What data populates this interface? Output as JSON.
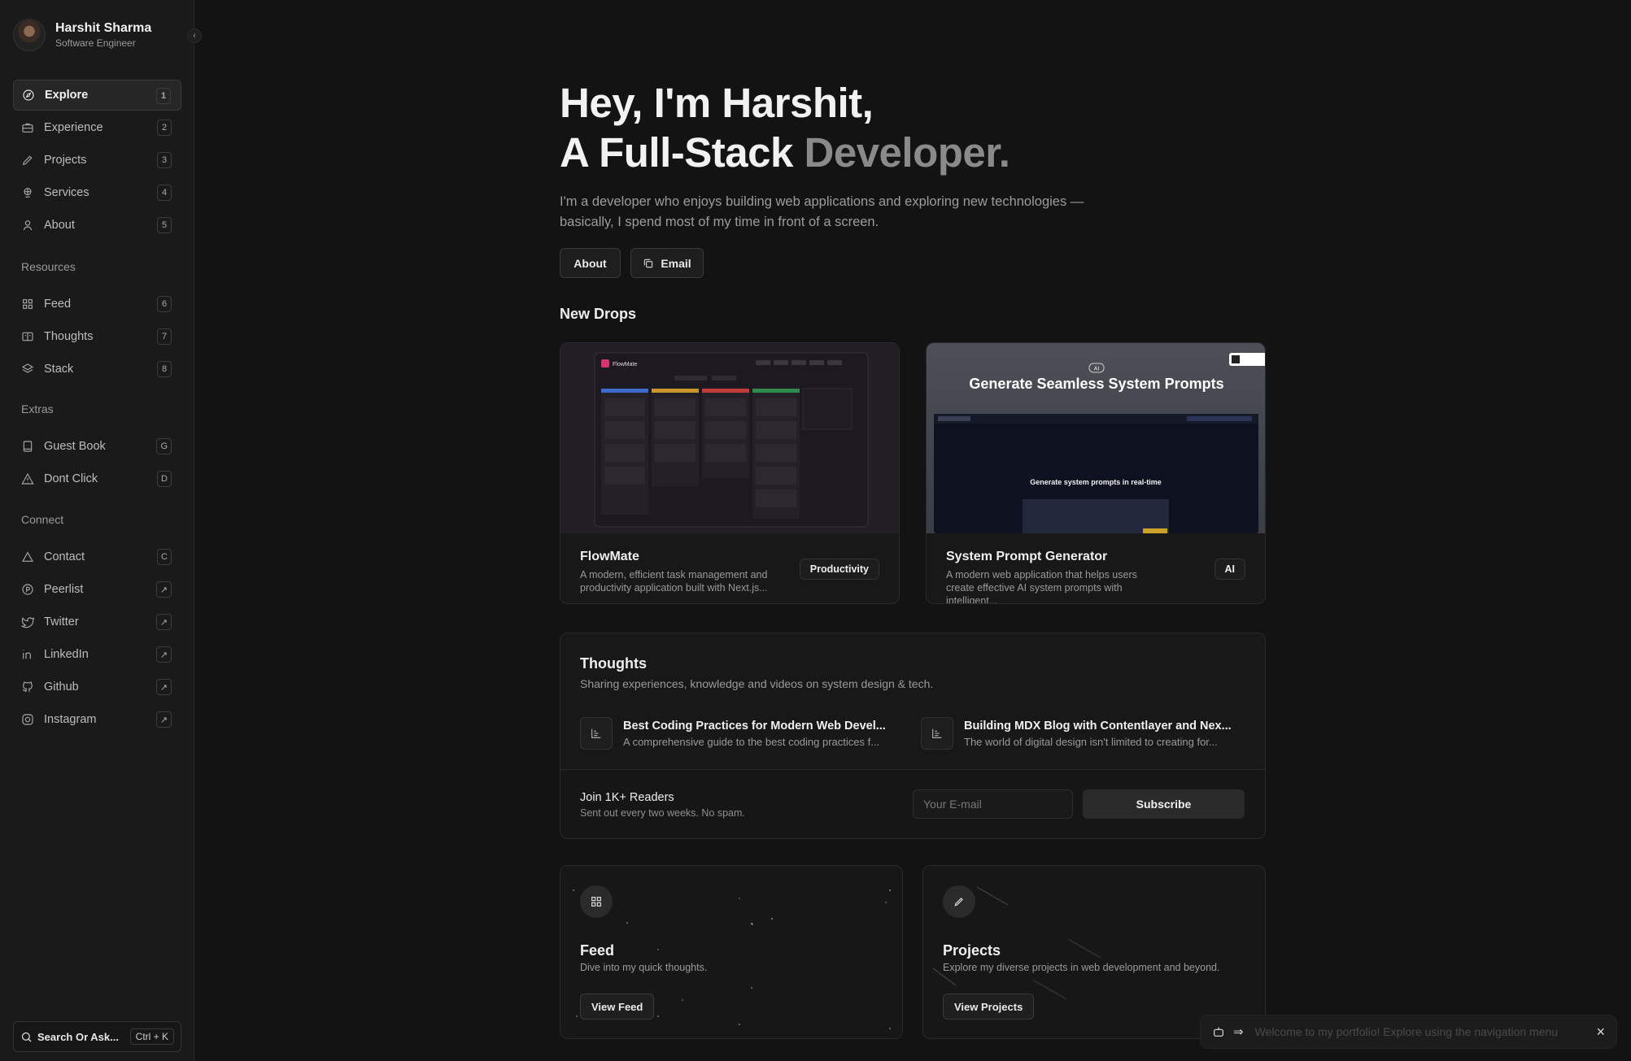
{
  "profile": {
    "name": "Harshit Sharma",
    "role": "Software Engineer"
  },
  "sidebar": {
    "main_items": [
      {
        "label": "Explore",
        "key": "1",
        "icon": "compass-icon"
      },
      {
        "label": "Experience",
        "key": "2",
        "icon": "briefcase-icon"
      },
      {
        "label": "Projects",
        "key": "3",
        "icon": "pencil-icon"
      },
      {
        "label": "Services",
        "key": "4",
        "icon": "services-icon"
      },
      {
        "label": "About",
        "key": "5",
        "icon": "user-icon"
      }
    ],
    "resources_label": "Resources",
    "resources_items": [
      {
        "label": "Feed",
        "key": "6",
        "icon": "grid-icon"
      },
      {
        "label": "Thoughts",
        "key": "7",
        "icon": "book-icon"
      },
      {
        "label": "Stack",
        "key": "8",
        "icon": "layers-icon"
      }
    ],
    "extras_label": "Extras",
    "extras_items": [
      {
        "label": "Guest Book",
        "key": "G",
        "icon": "guestbook-icon"
      },
      {
        "label": "Dont Click",
        "key": "D",
        "icon": "warning-icon"
      }
    ],
    "connect_label": "Connect",
    "connect_items": [
      {
        "label": "Contact",
        "key": "C",
        "icon": "triangle-icon"
      },
      {
        "label": "Peerlist",
        "key": "↗",
        "icon": "peerlist-icon"
      },
      {
        "label": "Twitter",
        "key": "↗",
        "icon": "twitter-icon"
      },
      {
        "label": "LinkedIn",
        "key": "↗",
        "icon": "linkedin-icon"
      },
      {
        "label": "Github",
        "key": "↗",
        "icon": "github-icon"
      },
      {
        "label": "Instagram",
        "key": "↗",
        "icon": "instagram-icon"
      }
    ],
    "search_label": "Search Or Ask...",
    "search_shortcut": "Ctrl + K"
  },
  "hero": {
    "line1": "Hey, I'm Harshit,",
    "line2_prefix": "A Full-Stack",
    "line2_muted": "Developer.",
    "description": "I'm a developer who enjoys building web applications and exploring new technologies — basically, I spend most of my time in front of a screen.",
    "about_button": "About",
    "email_button": "Email"
  },
  "new_drops": {
    "heading": "New Drops",
    "cards": [
      {
        "title": "FlowMate",
        "description": "A modern, efficient task management and productivity application built with Next.js...",
        "tag": "Productivity",
        "preview_app_name": "FlowMate"
      },
      {
        "title": "System Prompt Generator",
        "description": "A modern web application that helps users create effective AI system prompts with intelligent...",
        "tag": "AI",
        "preview_headline": "Generate Seamless System Prompts",
        "preview_badge": "AI",
        "preview_subheadline": "Generate system prompts in real-time"
      }
    ]
  },
  "thoughts": {
    "heading": "Thoughts",
    "subheading": "Sharing experiences, knowledge and videos on system design & tech.",
    "posts": [
      {
        "title": "Best Coding Practices for Modern Web Devel...",
        "description": "A comprehensive guide to the best coding practices f..."
      },
      {
        "title": "Building MDX Blog with Contentlayer and Nex...",
        "description": "The world of digital design isn't limited to creating for..."
      }
    ],
    "newsletter_title": "Join 1K+ Readers",
    "newsletter_sub": "Sent out every two weeks. No spam.",
    "email_placeholder": "Your E-mail",
    "subscribe_label": "Subscribe"
  },
  "features": [
    {
      "title": "Feed",
      "description": "Dive into my quick thoughts.",
      "button": "View Feed",
      "icon": "grid-icon"
    },
    {
      "title": "Projects",
      "description": "Explore my diverse projects in web development and beyond.",
      "button": "View Projects",
      "icon": "pencil-icon"
    }
  ],
  "toast": {
    "text": "Welcome to my portfolio! Explore using the navigation menu",
    "close": "×"
  }
}
